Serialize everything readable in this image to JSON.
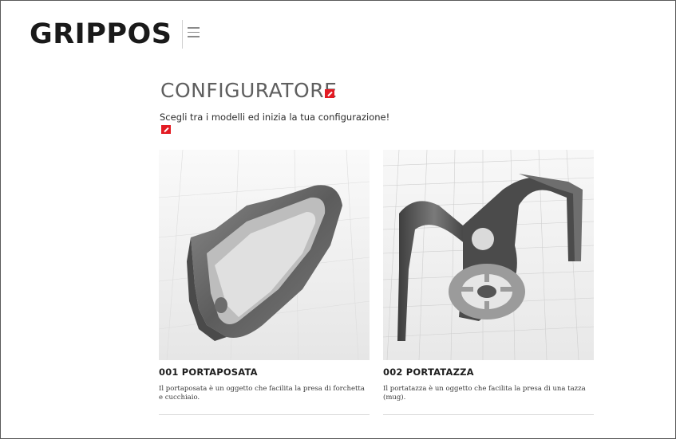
{
  "header": {
    "logo": "GRIPPOS",
    "menu_icon": "hamburger-icon"
  },
  "main": {
    "title": "CONFIGURATORE",
    "subtitle": "Scegli tra i modelli ed inizia la tua configurazione!",
    "edit_icon": "edit-icon",
    "accent_color": "#e31b23"
  },
  "products": [
    {
      "title": "001 PORTAPOSATA",
      "description": "Il portaposata è un oggetto che facilita la presa di forchetta e cucchiaio."
    },
    {
      "title": "002 PORTATAZZA",
      "description": "Il portatazza è un oggetto che facilita la presa di una tazza (mug)."
    }
  ]
}
